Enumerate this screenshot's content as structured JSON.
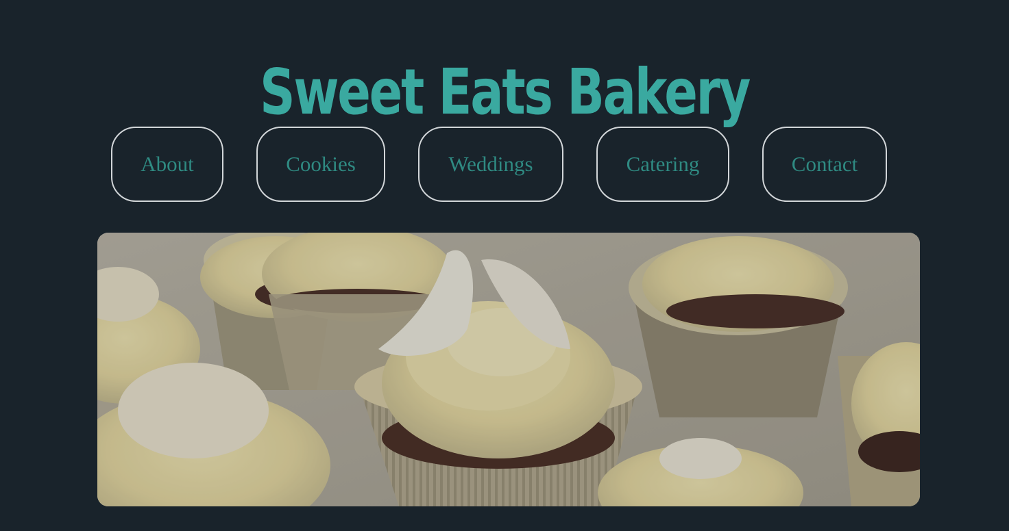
{
  "header": {
    "title": "Sweet Eats Bakery"
  },
  "nav": {
    "items": [
      {
        "label": "About"
      },
      {
        "label": "Cookies"
      },
      {
        "label": "Weddings"
      },
      {
        "label": "Catering"
      },
      {
        "label": "Contact"
      }
    ]
  },
  "hero": {
    "image_alt": "cupcakes-photo"
  },
  "colors": {
    "background": "#19232b",
    "accent": "#3aa9a0",
    "nav_text": "#2f8a82",
    "nav_border": "#d2d6d9"
  }
}
